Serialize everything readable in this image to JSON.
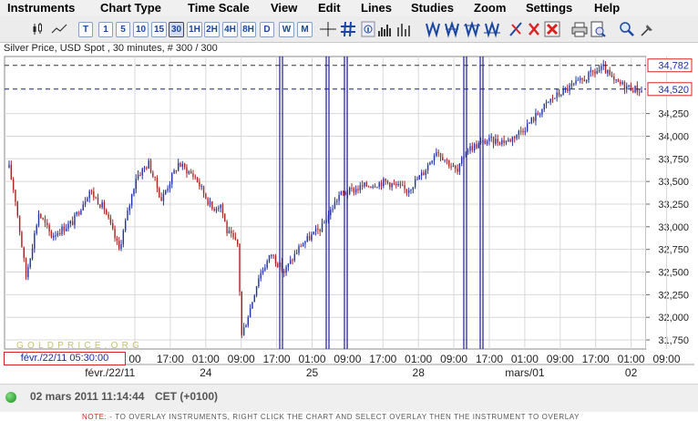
{
  "menu": [
    "Instruments",
    "Chart Type",
    "Time Scale",
    "View",
    "Edit",
    "Lines",
    "Studies",
    "Zoom",
    "Settings",
    "Help"
  ],
  "toolbar": {
    "timeframes": [
      "T",
      "1",
      "5",
      "10",
      "15",
      "30",
      "1H",
      "2H",
      "4H",
      "8H",
      "D",
      "W",
      "M"
    ],
    "selected": "30",
    "icons": [
      "candlestick-chart-icon",
      "line-chart-icon",
      "crosshair-icon",
      "grid-icon",
      "info-icon",
      "volume-bars-icon",
      "trendline-icon",
      "fibonacci-icon",
      "channel-icon",
      "parallel-lines-icon",
      "delete-line-icon",
      "delete-selected-icon",
      "delete-all-icon",
      "print-icon",
      "print-preview-icon",
      "zoom-icon",
      "pin-icon"
    ]
  },
  "chart_title": "Silver Price, USD Spot , 30 minutes, # 300 / 300",
  "watermark": "GOLDPRICE.ORG",
  "timestamp_box": "févr./22/11 05:30:00",
  "status": {
    "datetime": "02 mars 2011 11:14:44",
    "timezone": "CET (+0100)"
  },
  "note": {
    "label": "NOTE:",
    "text": "- TO OVERLAY INSTRUMENTS, RIGHT CLICK THE CHART AND SELECT OVERLAY THEN THE INSTRUMENT TO OVERLAY"
  },
  "chart_data": {
    "type": "candlestick",
    "instrument": "Silver Price, USD Spot",
    "interval": "30 minutes",
    "y_ticks": [
      "31,750",
      "32,000",
      "32,250",
      "32,500",
      "32,750",
      "33,000",
      "33,250",
      "33,500",
      "33,750",
      "34,000",
      "34,250"
    ],
    "y_range": [
      31650,
      34880
    ],
    "price_markers": [
      {
        "label": "34,782",
        "value": 34782
      },
      {
        "label": "34,520",
        "value": 34520
      }
    ],
    "x_tick_labels": [
      {
        "label": "00",
        "slot": 0
      },
      {
        "label": "17:00",
        "slot": 1
      },
      {
        "label": "01:00",
        "slot": 2
      },
      {
        "label": "09:00",
        "slot": 3
      },
      {
        "label": "17:00",
        "slot": 4
      },
      {
        "label": "01:00",
        "slot": 5
      },
      {
        "label": "09:00",
        "slot": 6
      },
      {
        "label": "17:00",
        "slot": 7
      },
      {
        "label": "01:00",
        "slot": 8
      },
      {
        "label": "09:00",
        "slot": 9
      },
      {
        "label": "17:00",
        "slot": 10
      },
      {
        "label": "01:00",
        "slot": 11
      },
      {
        "label": "09:00",
        "slot": 12
      },
      {
        "label": "17:00",
        "slot": 13
      },
      {
        "label": "01:00",
        "slot": 14
      },
      {
        "label": "09:00",
        "slot": 15
      }
    ],
    "day_labels": [
      {
        "label": "févr./22/11",
        "slot": -0.7
      },
      {
        "label": "24",
        "slot": 2
      },
      {
        "label": "25",
        "slot": 5
      },
      {
        "label": "28",
        "slot": 8
      },
      {
        "label": "mars/01",
        "slot": 11
      },
      {
        "label": "02",
        "slot": 14
      }
    ],
    "anchors": [
      [
        0,
        33650
      ],
      [
        3,
        33300
      ],
      [
        8,
        32450
      ],
      [
        14,
        33150
      ],
      [
        20,
        32900
      ],
      [
        30,
        33050
      ],
      [
        38,
        33400
      ],
      [
        45,
        33200
      ],
      [
        52,
        32750
      ],
      [
        60,
        33550
      ],
      [
        66,
        33700
      ],
      [
        72,
        33300
      ],
      [
        80,
        33700
      ],
      [
        88,
        33550
      ],
      [
        96,
        33200
      ],
      [
        100,
        33250
      ],
      [
        103,
        32950
      ],
      [
        108,
        32800
      ],
      [
        110,
        31800
      ],
      [
        114,
        32100
      ],
      [
        118,
        32450
      ],
      [
        124,
        32700
      ],
      [
        130,
        32500
      ],
      [
        138,
        32800
      ],
      [
        148,
        33000
      ],
      [
        156,
        33350
      ],
      [
        168,
        33450
      ],
      [
        178,
        33500
      ],
      [
        188,
        33400
      ],
      [
        196,
        33600
      ],
      [
        202,
        33850
      ],
      [
        208,
        33700
      ],
      [
        212,
        33600
      ],
      [
        216,
        33850
      ],
      [
        226,
        33950
      ],
      [
        236,
        33950
      ],
      [
        244,
        34100
      ],
      [
        250,
        34250
      ],
      [
        256,
        34400
      ],
      [
        262,
        34500
      ],
      [
        270,
        34600
      ],
      [
        276,
        34700
      ],
      [
        281,
        34750
      ],
      [
        286,
        34600
      ],
      [
        292,
        34550
      ],
      [
        299,
        34500
      ]
    ],
    "volatility": 40
  }
}
